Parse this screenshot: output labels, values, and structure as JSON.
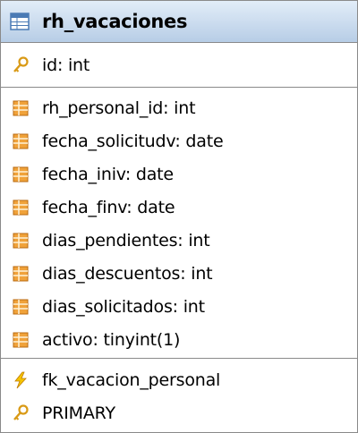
{
  "table": {
    "name": "rh_vacaciones",
    "primary_key": [
      {
        "label": "id: int",
        "icon": "key-icon"
      }
    ],
    "columns": [
      {
        "label": "rh_personal_id: int",
        "icon": "column-icon"
      },
      {
        "label": "fecha_solicitudv: date",
        "icon": "column-icon"
      },
      {
        "label": "fecha_iniv: date",
        "icon": "column-icon"
      },
      {
        "label": "fecha_finv: date",
        "icon": "column-icon"
      },
      {
        "label": "dias_pendientes: int",
        "icon": "column-icon"
      },
      {
        "label": "dias_descuentos: int",
        "icon": "column-icon"
      },
      {
        "label": "dias_solicitados: int",
        "icon": "column-icon"
      },
      {
        "label": "activo: tinyint(1)",
        "icon": "column-icon"
      }
    ],
    "indexes": [
      {
        "label": "fk_vacacion_personal",
        "icon": "lightning-icon"
      },
      {
        "label": "PRIMARY",
        "icon": "key-icon"
      }
    ]
  },
  "colors": {
    "header_top": "#e2edf8",
    "header_bottom": "#b7cde6",
    "border": "#8a8a8a",
    "column_icon": "#f0a23a",
    "key_icon": "#d99a16",
    "lightning_icon": "#f5c400"
  }
}
